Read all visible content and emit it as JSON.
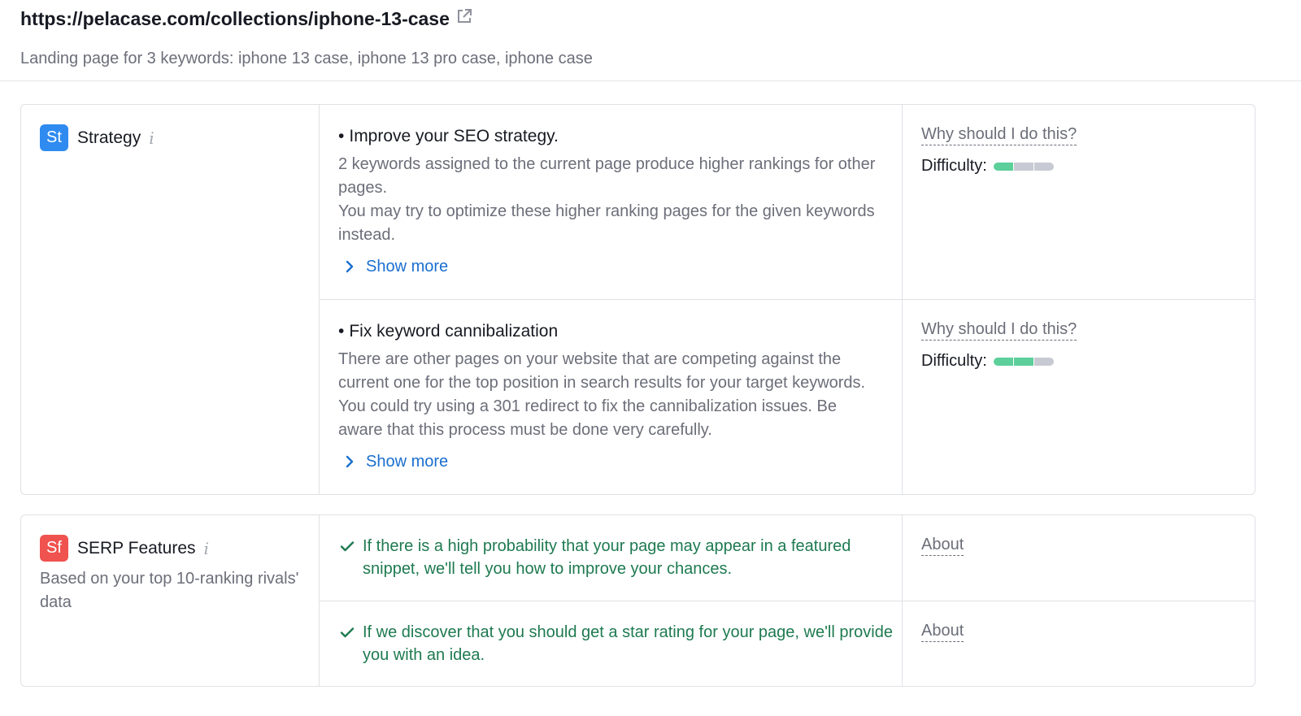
{
  "header": {
    "url": "https://pelacase.com/collections/iphone-13-case",
    "subtitle": "Landing page for 3 keywords: iphone 13 case, iphone 13 pro case, iphone case"
  },
  "strategy": {
    "badge": "St",
    "title": "Strategy",
    "info": "i",
    "tasks": [
      {
        "title": "Improve your SEO strategy.",
        "body1": "2 keywords assigned to the current page produce higher rankings for other pages.",
        "body2": "You may try to optimize these higher ranking pages for the given keywords instead.",
        "show_more": "Show more",
        "why": "Why should I do this?",
        "difficulty_label": "Difficulty:",
        "difficulty_level": 1,
        "difficulty_max": 3
      },
      {
        "title": "Fix keyword cannibalization",
        "body1": "There are other pages on your website that are competing against the current one for the top position in search results for your target keywords. You could try using a 301 redirect to fix the cannibalization issues. Be aware that this process must be done very carefully.",
        "show_more": "Show more",
        "why": "Why should I do this?",
        "difficulty_label": "Difficulty:",
        "difficulty_level": 2,
        "difficulty_max": 3
      }
    ]
  },
  "serp": {
    "badge": "Sf",
    "title": "SERP Features",
    "info": "i",
    "description": "Based on your top 10-ranking rivals' data",
    "items": [
      {
        "text": "If there is a high probability that your page may appear in a featured snippet, we'll tell you how to improve your chances.",
        "about": "About"
      },
      {
        "text": "If we discover that you should get a star rating for your page, we'll provide you with an idea.",
        "about": "About"
      }
    ]
  },
  "colors": {
    "accent_link": "#1a6fcf",
    "success_text": "#1e7a50",
    "difficulty_on": "#5ccf9a",
    "difficulty_off": "#c7cad3",
    "badge_strategy": "#2f8bf0",
    "badge_serp": "#f0524f"
  }
}
